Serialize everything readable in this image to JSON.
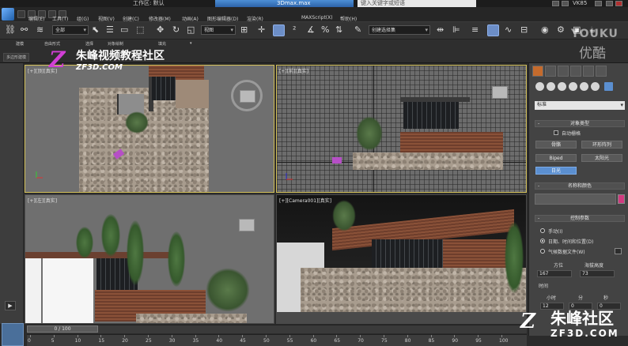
{
  "titlebar": {
    "workspace_label": "工作区: 默认",
    "file_label": "3Dmax.max",
    "search_placeholder": "键入关键字或短语",
    "user_label": "VK85"
  },
  "menu": {
    "items": [
      "编辑(E)",
      "工具(T)",
      "组(G)",
      "视图(V)",
      "创建(C)",
      "修改器(M)",
      "动画(A)",
      "图形编辑器(D)",
      "渲染(R)",
      "MAXScript(X)",
      "帮助(H)"
    ]
  },
  "toolbar": {
    "filter_dropdown": "全部",
    "refcoord_dropdown": "视图",
    "selset_dropdown": "创建选择集"
  },
  "ribbon": {
    "tabs": [
      "建模",
      "自由形式",
      "选择",
      "对象绘制",
      "填充"
    ],
    "sub_label": "多边形建模"
  },
  "watermarks": {
    "zf_name": "朱峰视频教程社区",
    "zf_url": "ZF3D.COM",
    "youku_en": "YOUKU",
    "youku_cn": "优酷",
    "bottom_name": "朱峰社区",
    "bottom_url": "ZF3D.COM",
    "z_glyph": "Z"
  },
  "viewports": {
    "top": "[+][顶][真实]",
    "front": "[+][前][真实]",
    "left": "[+][左][真实]",
    "camera": "[+][Camera001][真实]"
  },
  "command_panel": {
    "category_dropdown": "标准",
    "rollout_object_type": "对象类型",
    "autogrid_label": "自动栅格",
    "buttons": [
      "骨骼",
      "环形阵列",
      "Biped",
      "太阳光",
      "日光"
    ],
    "rollout_name_color": "名称和颜色",
    "rollout_control": "控制参数",
    "radio_manual": "手动(I)",
    "radio_datetime": "日期、时间和位置(D)",
    "radio_weather": "气候数据文件(W)",
    "azimuth_label": "方位",
    "altitude_label": "海拔高度",
    "azimuth_value": "167",
    "altitude_value": "73",
    "time_label": "时间",
    "hour_label": "小时",
    "minute_label": "分",
    "second_label": "秒",
    "hour_value": "12",
    "minute_value": "0",
    "second_value": "0",
    "pm": "-"
  },
  "timeline": {
    "slider_label": "0 / 100",
    "ticks": [
      "0",
      "5",
      "10",
      "15",
      "20",
      "25",
      "30",
      "35",
      "40",
      "45",
      "50",
      "55",
      "60",
      "65",
      "70",
      "75",
      "80",
      "85",
      "90",
      "95",
      "100"
    ]
  },
  "colors": {
    "accent_active": "#d4c15a",
    "brand_magenta": "#d23fd6",
    "selected_button": "#5b8fd0"
  }
}
